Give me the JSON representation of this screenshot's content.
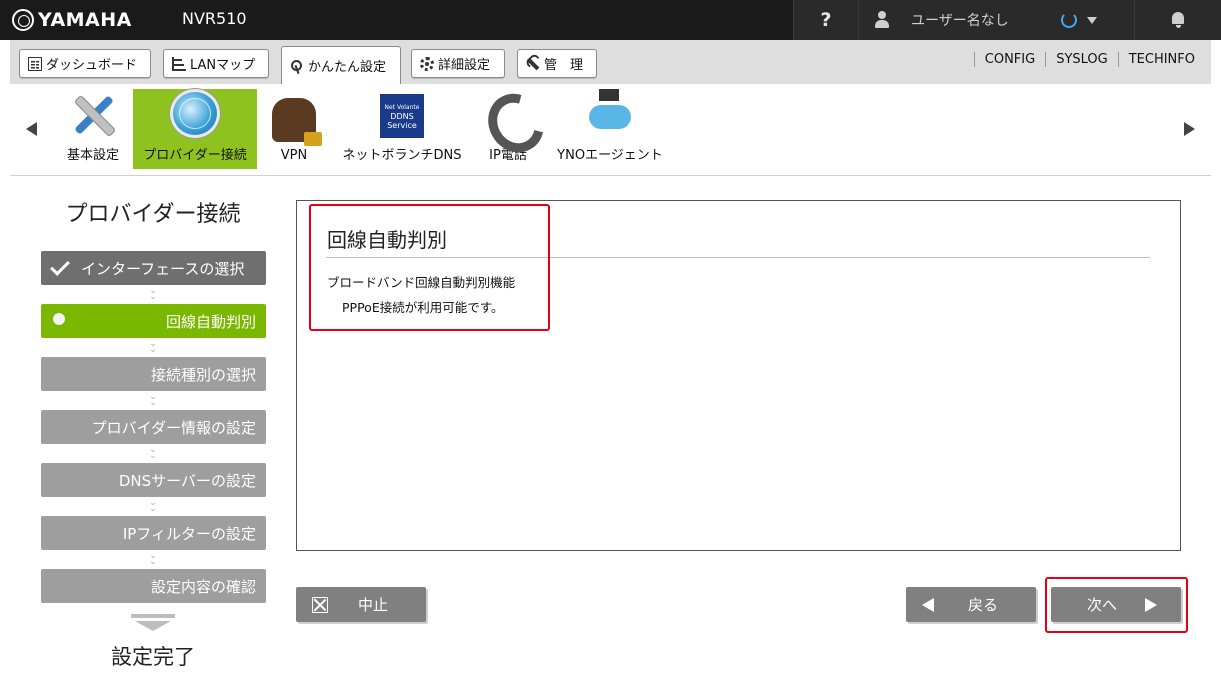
{
  "header": {
    "brand": "YAMAHA",
    "model": "NVR510",
    "help": "?",
    "user": "ユーザー名なし"
  },
  "menu": {
    "tabs": [
      "ダッシュボード",
      "LANマップ",
      "かんたん設定",
      "詳細設定",
      "管　理"
    ],
    "active_tab": "かんたん設定",
    "links": [
      "CONFIG",
      "SYSLOG",
      "TECHINFO"
    ]
  },
  "apps": {
    "items": [
      "基本設定",
      "プロバイダー接続",
      "VPN",
      "ネットボランチDNS",
      "IP電話",
      "YNOエージェント"
    ],
    "active": "プロバイダー接続",
    "ddns_icon_text": [
      "Net Volante",
      "DDNS",
      "Service"
    ]
  },
  "wizard": {
    "title": "プロバイダー接続",
    "steps": [
      {
        "label": "インターフェースの選択",
        "state": "done"
      },
      {
        "label": "回線自動判別",
        "state": "current"
      },
      {
        "label": "接続種別の選択",
        "state": "pending"
      },
      {
        "label": "プロバイダー情報の設定",
        "state": "pending"
      },
      {
        "label": "DNSサーバーの設定",
        "state": "pending"
      },
      {
        "label": "IPフィルターの設定",
        "state": "pending"
      },
      {
        "label": "設定内容の確認",
        "state": "pending"
      }
    ],
    "final": "設定完了"
  },
  "panel": {
    "title": "回線自動判別",
    "line1": "ブロードバンド回線自動判別機能",
    "line2": "PPPoE接続が利用可能です。"
  },
  "buttons": {
    "cancel": "中止",
    "back": "戻る",
    "next": "次へ"
  },
  "colors": {
    "active_green": "#8dc21f",
    "step_current": "#7ab800",
    "highlight_red": "#e60012"
  }
}
